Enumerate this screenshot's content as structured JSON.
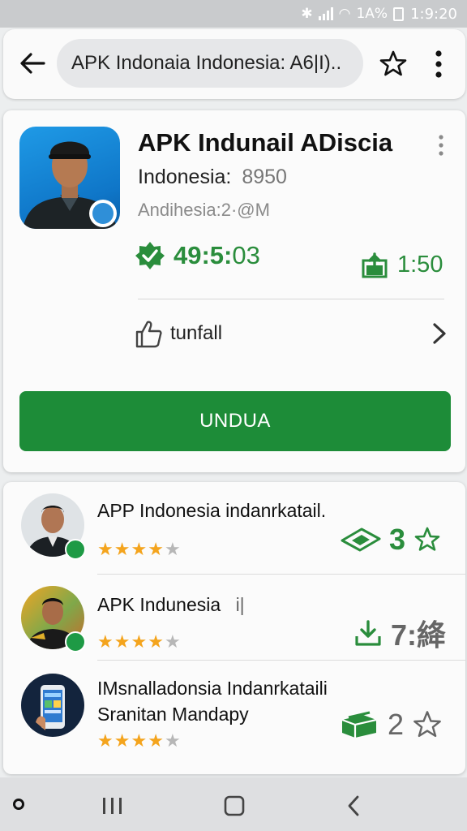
{
  "status_bar": {
    "network": "1A%",
    "time": "1:9:20"
  },
  "search": {
    "query": "APK Indonaia Indonesia: A6|I).."
  },
  "app": {
    "title": "APK Indunail ADiscia",
    "subtitle_label": "Indonesia:",
    "subtitle_value": "8950",
    "meta": "Andihesia:2·@M",
    "rating_value_main": "49:5:",
    "rating_value_tail": "03",
    "downloads_value": "1:50",
    "tag_label": "tunfall",
    "install_label": "UNDUA"
  },
  "list": {
    "items": [
      {
        "title": "APP Indonesia indanrkatail.",
        "stars_on": 4,
        "stars_total": 5,
        "count": "3"
      },
      {
        "title": "APK Indunesia",
        "title_suffix": "i|",
        "stars_on": 4,
        "stars_total": 5,
        "count": "7:絳"
      },
      {
        "title": "IMsnalladonsia Indanrkataili",
        "title_line2": "Sranitan Mandapy",
        "stars_on": 4,
        "stars_total": 5,
        "count": "2"
      }
    ]
  },
  "colors": {
    "accent_green": "#1d8c38",
    "text_green": "#2a8d3c",
    "star_gold": "#f4a41d",
    "brand_blue": "#1f9ae6"
  },
  "icons": [
    "back-arrow-icon",
    "star-outline-icon",
    "more-vert-icon",
    "thumbs-up-icon",
    "chevron-right-icon",
    "download-icon",
    "ticket-icon",
    "package-icon"
  ]
}
